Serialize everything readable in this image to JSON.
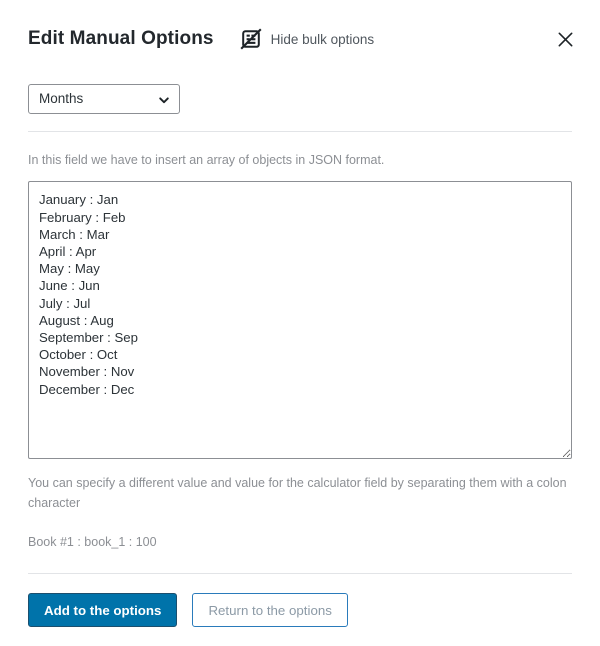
{
  "header": {
    "title": "Edit Manual Options",
    "bulk_toggle_label": "Hide bulk options",
    "bulk_toggle_icon": "form-hidden-icon",
    "close_icon": "close-icon"
  },
  "option_select": {
    "selected": "Months",
    "options": [
      "Months"
    ],
    "chevron_icon": "chevron-down-icon"
  },
  "hints": {
    "top": "In this field we have to insert an array of objects in JSON format.",
    "bottom": "You can specify a different value and value for the calculator field by separating them with a colon character",
    "example": "Book #1 : book_1 : 100"
  },
  "bulk_field": {
    "placeholder": "",
    "lines": [
      "January : Jan",
      "February : Feb",
      "March : Mar",
      "April : Apr",
      "May : May",
      "June : Jun",
      "July : Jul",
      "August : Aug",
      "September : Sep",
      "October : Oct",
      "November : Nov",
      "December : Dec"
    ],
    "value": "January : Jan\nFebruary : Feb\nMarch : Mar\nApril : Apr\nMay : May\nJune : Jun\nJuly : Jul\nAugust : Aug\nSeptember : Sep\nOctober : Oct\nNovember : Nov\nDecember : Dec"
  },
  "footer": {
    "primary_label": "Add to the options",
    "secondary_label": "Return to the options"
  },
  "colors": {
    "primary_blue": "#0073aa",
    "primary_border": "#1b4f6e",
    "secondary_border": "#2a7bbb",
    "secondary_text": "#8c9aa6",
    "hint_text": "#8c8f94",
    "divider": "#e2e4e7",
    "title_text": "#23282d",
    "field_border": "#8c8f94"
  }
}
